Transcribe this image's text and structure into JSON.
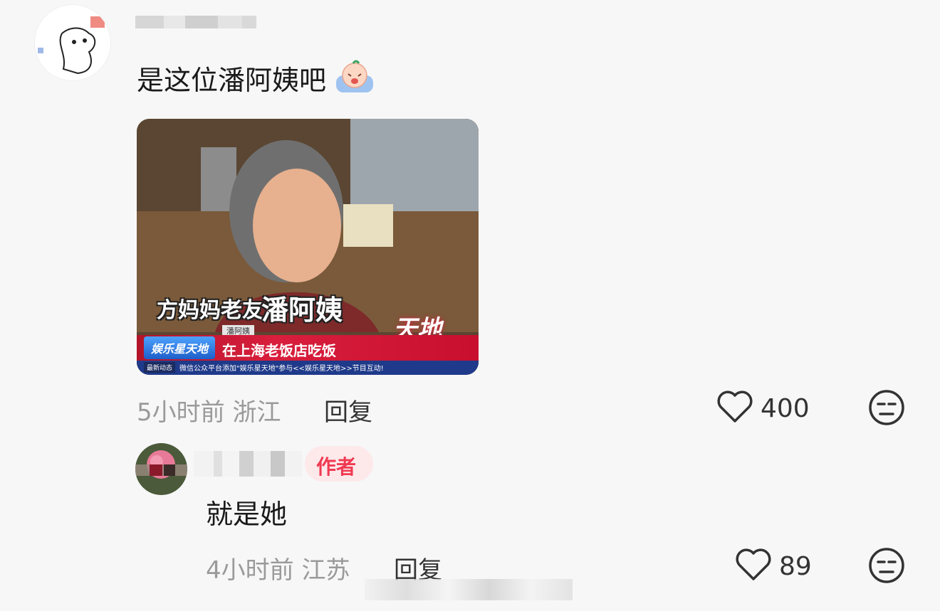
{
  "comments": [
    {
      "text": "是这位潘阿姨吧",
      "emoji_icon": "crying-face-emoji",
      "image": {
        "caption_prefix": "方妈妈老友：",
        "caption_name": "潘阿姨",
        "ticker_text": "在上海老饭店吃饭",
        "show_logo": "娱乐星天地",
        "channel_logo": "天地",
        "label_small": "潘阿姨",
        "bottom_badge": "最新动态",
        "bottom_ticker": "微信公众平台添加\"娱乐星天地\"参与<<娱乐星天地>>节目互动!"
      },
      "time": "5小时前",
      "location": "浙江",
      "reply_label": "回复",
      "likes": "400"
    },
    {
      "author_badge": "作者",
      "text": "就是她",
      "time": "4小时前",
      "location": "江苏",
      "reply_label": "回复",
      "likes": "89"
    }
  ],
  "colors": {
    "background": "#f7f7f7",
    "meta_gray": "#9a9a9a",
    "author_badge_bg": "#fde8ea",
    "author_badge_text": "#f03a52"
  }
}
